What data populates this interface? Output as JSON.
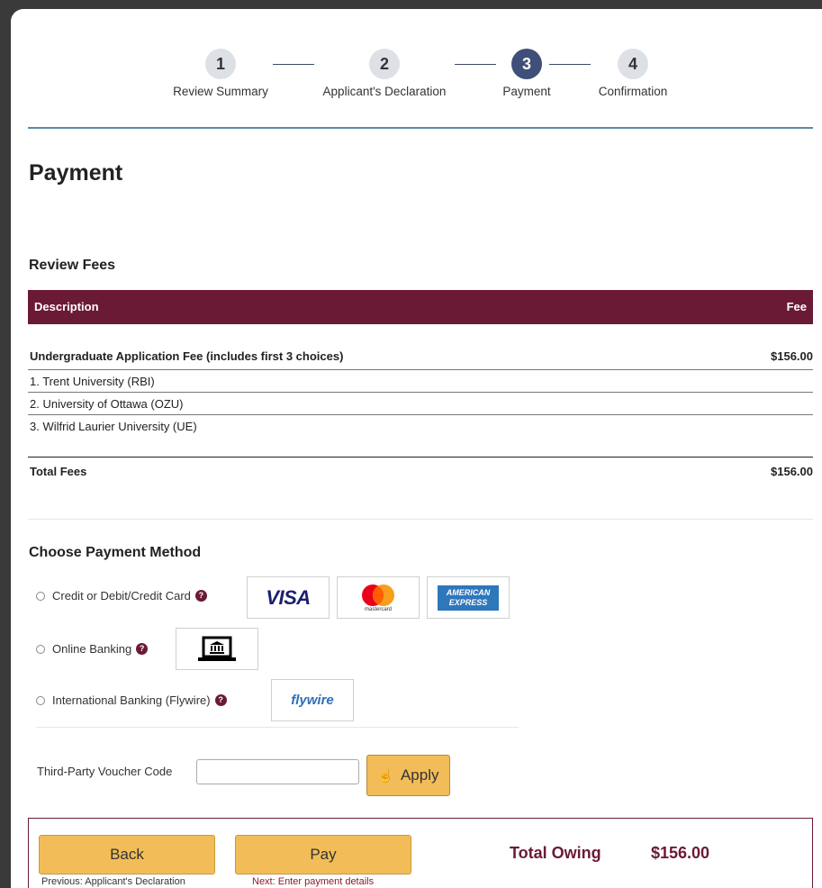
{
  "stepper": {
    "steps": [
      {
        "number": "1",
        "label": "Review Summary"
      },
      {
        "number": "2",
        "label": "Applicant's Declaration"
      },
      {
        "number": "3",
        "label": "Payment"
      },
      {
        "number": "4",
        "label": "Confirmation"
      }
    ],
    "active_step": 3
  },
  "page": {
    "title": "Payment"
  },
  "fees": {
    "heading": "Review Fees",
    "columns": {
      "description": "Description",
      "fee": "Fee"
    },
    "main_item": {
      "description": "Undergraduate Application Fee (includes first 3 choices)",
      "fee": "$156.00"
    },
    "choices": [
      "1. Trent University (RBI)",
      "2. University of Ottawa (OZU)",
      "3. Wilfrid Laurier University (UE)"
    ],
    "total": {
      "label": "Total Fees",
      "amount": "$156.00"
    }
  },
  "payment_method": {
    "heading": "Choose Payment Method",
    "options": [
      {
        "label": "Credit or Debit/Credit Card",
        "selected": false
      },
      {
        "label": "Online Banking",
        "selected": false
      },
      {
        "label": "International Banking (Flywire)",
        "selected": false
      }
    ],
    "logos": {
      "visa": "VISA",
      "mastercard": "mastercard",
      "amex_line1": "AMERICAN",
      "amex_line2": "EXPRESS",
      "flywire": "flywire"
    },
    "help_glyph": "?"
  },
  "voucher": {
    "label": "Third-Party Voucher Code",
    "value": "",
    "apply_label": "Apply"
  },
  "footer": {
    "back_label": "Back",
    "back_hint": "Previous: Applicant's Declaration",
    "pay_label": "Pay",
    "pay_hint": "Next: Enter payment details",
    "total_owing_label": "Total Owing",
    "total_owing_amount": "$156.00"
  },
  "colors": {
    "brand_maroon": "#6b1a35",
    "button_gold": "#f2bd58",
    "active_step": "#3f4f7a",
    "inactive_step": "#dde1e6",
    "rule_blue": "#5e8ba3"
  }
}
